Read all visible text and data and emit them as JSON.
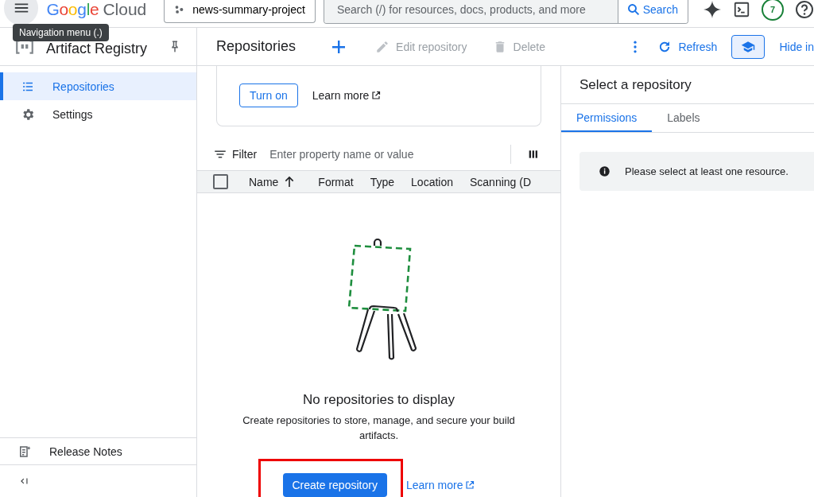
{
  "header": {
    "menu_tooltip": "Navigation menu (.)",
    "logo_word": "Google",
    "product": "Cloud",
    "project": "news-summary-project",
    "search_placeholder": "Search (/) for resources, docs, products, and more",
    "search_button": "Search",
    "notification_count": "7"
  },
  "sidebar": {
    "title": "Artifact Registry",
    "items": [
      {
        "label": "Repositories",
        "selected": true,
        "kind": "list"
      },
      {
        "label": "Settings",
        "selected": false,
        "kind": "gear"
      }
    ],
    "footer_items": [
      {
        "label": "Release Notes",
        "kind": "notes"
      }
    ]
  },
  "toolbar": {
    "title": "Repositories",
    "actions": [
      {
        "label": "Edit repository",
        "disabled": true,
        "kind": "edit"
      },
      {
        "label": "Delete",
        "disabled": true,
        "kind": "delete"
      }
    ],
    "refresh": "Refresh",
    "learn_toggle": {
      "on": true
    },
    "hide_info": "Hide in"
  },
  "banner": {
    "button": "Turn on",
    "link": "Learn more"
  },
  "filter": {
    "label": "Filter",
    "placeholder": "Enter property name or value"
  },
  "table": {
    "select_all": {
      "checked": false
    },
    "columns": [
      {
        "label": "Name",
        "sorted": true
      },
      {
        "label": "Format",
        "sorted": false
      },
      {
        "label": "Type",
        "sorted": false
      },
      {
        "label": "Location",
        "sorted": false
      },
      {
        "label": "Scanning (D",
        "sorted": false
      }
    ]
  },
  "empty_state": {
    "title": "No repositories to display",
    "description": "Create repositories to store, manage, and secure your build artifacts.",
    "button": "Create repository",
    "link": "Learn more",
    "highlighted": true
  },
  "details": {
    "title": "Select a repository",
    "tabs": [
      {
        "label": "Permissions",
        "selected": true
      },
      {
        "label": "Labels",
        "selected": false
      }
    ],
    "notice": "Please select at least one resource."
  }
}
